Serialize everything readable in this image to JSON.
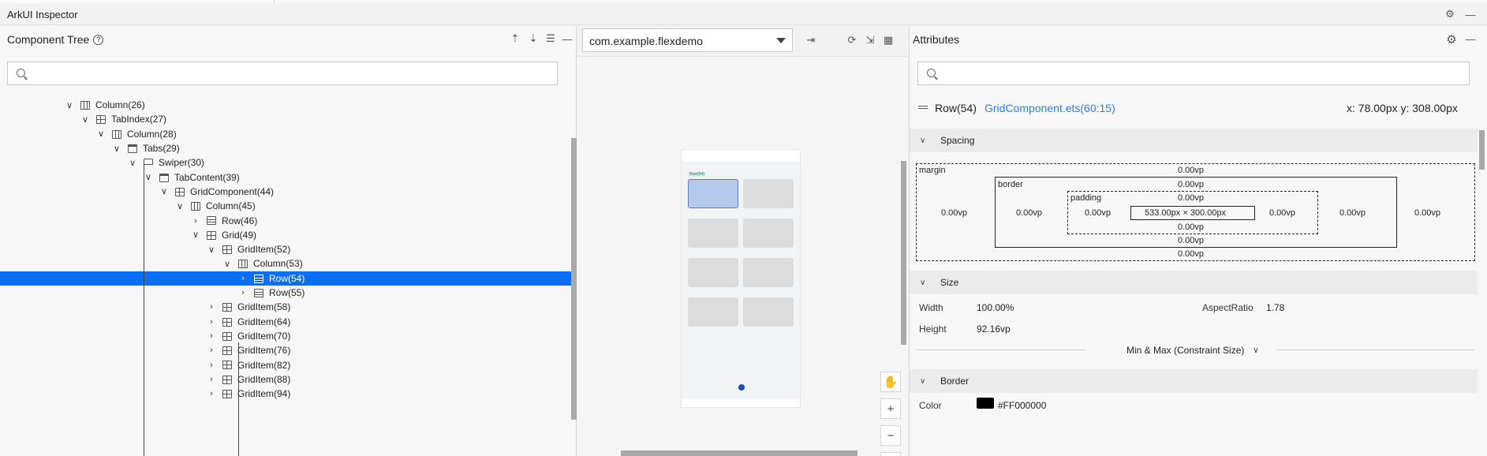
{
  "app": {
    "title": "ArkUI Inspector"
  },
  "component_tree": {
    "title": "Component Tree",
    "search_placeholder": "",
    "nodes": [
      {
        "label": "Column(26)",
        "icon": "column-icon",
        "expanded": true
      },
      {
        "label": "TabIndex(27)",
        "icon": "tabindex-icon",
        "expanded": true
      },
      {
        "label": "Column(28)",
        "icon": "column-icon",
        "expanded": true
      },
      {
        "label": "Tabs(29)",
        "icon": "tabs-icon",
        "expanded": true
      },
      {
        "label": "Swiper(30)",
        "icon": "swiper-icon",
        "expanded": true
      },
      {
        "label": "TabContent(39)",
        "icon": "tabcontent-icon",
        "expanded": true
      },
      {
        "label": "GridComponent(44)",
        "icon": "component-icon",
        "expanded": true
      },
      {
        "label": "Column(45)",
        "icon": "column-icon",
        "expanded": true
      },
      {
        "label": "Row(46)",
        "icon": "row-icon",
        "expanded": false
      },
      {
        "label": "Grid(49)",
        "icon": "grid-icon",
        "expanded": true
      },
      {
        "label": "GridItem(52)",
        "icon": "griditem-icon",
        "expanded": true
      },
      {
        "label": "Column(53)",
        "icon": "column-icon",
        "expanded": true
      },
      {
        "label": "Row(54)",
        "icon": "row-icon",
        "expanded": false,
        "selected": true
      },
      {
        "label": "Row(55)",
        "icon": "row-icon",
        "expanded": false
      },
      {
        "label": "GridItem(58)",
        "icon": "griditem-icon",
        "expanded": false
      },
      {
        "label": "GridItem(64)",
        "icon": "griditem-icon",
        "expanded": false
      },
      {
        "label": "GridItem(70)",
        "icon": "griditem-icon",
        "expanded": false
      },
      {
        "label": "GridItem(76)",
        "icon": "griditem-icon",
        "expanded": false
      },
      {
        "label": "GridItem(82)",
        "icon": "griditem-icon",
        "expanded": false
      },
      {
        "label": "GridItem(88)",
        "icon": "griditem-icon",
        "expanded": false
      },
      {
        "label": "GridItem(94)",
        "icon": "griditem-icon",
        "expanded": false
      }
    ]
  },
  "device": {
    "selected_app": "com.example.flexdemo",
    "preview": {
      "tag": "Row(54)"
    }
  },
  "attributes": {
    "title": "Attributes",
    "search_placeholder": "",
    "component_name": "Row(54)",
    "source_link": "GridComponent.ets(60:15)",
    "position": "x: 78.00px  y: 308.00px",
    "spacing": {
      "section": "Spacing",
      "margin_label": "margin",
      "border_label": "border",
      "padding_label": "padding",
      "margin_top": "0.00vp",
      "margin_bottom": "0.00vp",
      "margin_left": "0.00vp",
      "margin_right": "0.00vp",
      "border_top": "0.00vp",
      "border_bottom": "0.00vp",
      "border_left": "0.00vp",
      "border_right": "0.00vp",
      "padding_top": "0.00vp",
      "padding_bottom": "0.00vp",
      "padding_left": "0.00vp",
      "padding_right": "0.00vp",
      "content": "533.00px × 300.00px"
    },
    "size": {
      "section": "Size",
      "width_label": "Width",
      "width": "100.00%",
      "height_label": "Height",
      "height": "92.16vp",
      "aspect_label": "AspectRatio",
      "aspect": "1.78",
      "constraint": "Min & Max (Constraint Size)"
    },
    "border": {
      "section": "Border",
      "color_label": "Color",
      "color": "#FF000000"
    }
  },
  "colors": {
    "selection": "#0a6ff5",
    "link": "#2f7fd4"
  }
}
